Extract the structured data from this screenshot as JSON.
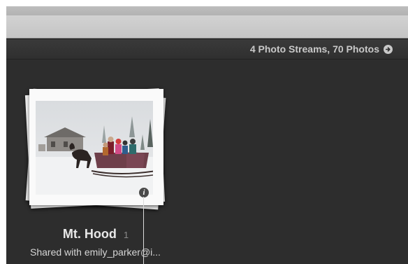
{
  "header": {
    "summary": "4 Photo Streams, 70 Photos",
    "summary_icon": "arrow-right-circle-icon"
  },
  "stream": {
    "title": "Mt. Hood",
    "count": "1",
    "shared_with": "Shared with emily_parker@i...",
    "info_icon": "info-icon",
    "info_glyph": "i"
  },
  "colors": {
    "background": "#2d2d2d",
    "toolbar": "#c8c8c8",
    "text_primary": "#e8e8e8",
    "text_secondary": "#c9c9c9"
  }
}
